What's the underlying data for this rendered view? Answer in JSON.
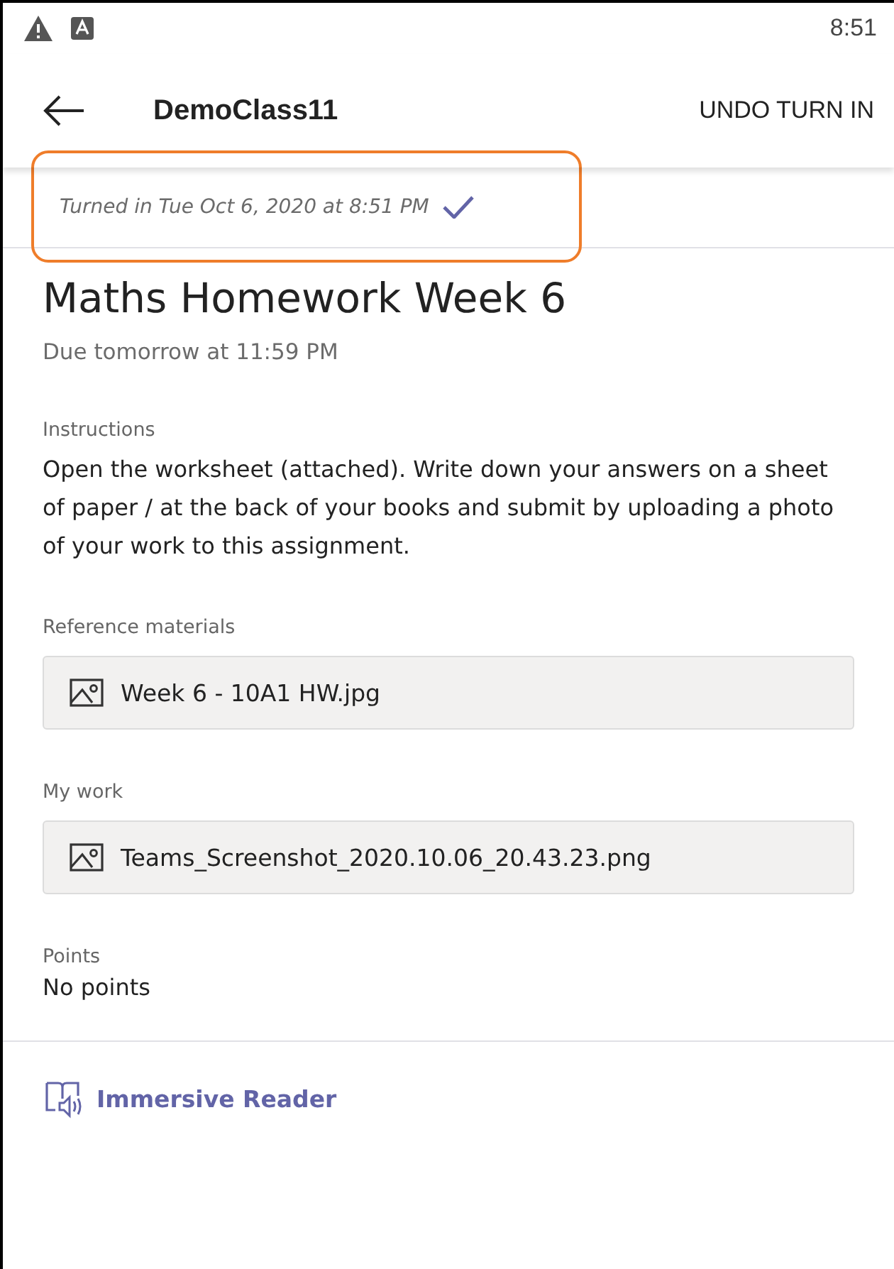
{
  "status_bar": {
    "time": "8:51"
  },
  "app_bar": {
    "title": "DemoClass11",
    "action": "UNDO TURN IN"
  },
  "turned_in": {
    "text": "Turned in Tue Oct 6, 2020 at 8:51 PM",
    "checked": true
  },
  "assignment": {
    "title": "Maths Homework Week 6",
    "due": "Due tomorrow at 11:59 PM"
  },
  "sections": [
    {
      "label": "Instructions",
      "kind": "text",
      "text": "Open the worksheet (attached).  Write down your answers on a sheet of paper / at the back of your books and submit by uploading a photo of your work to this assignment."
    },
    {
      "label": "Reference materials",
      "kind": "file",
      "file": "Week 6 - 10A1 HW.jpg"
    },
    {
      "label": "My work",
      "kind": "file",
      "file": "Teams_Screenshot_2020.10.06_20.43.23.png"
    },
    {
      "label": "Points",
      "kind": "value",
      "text": "No points"
    }
  ],
  "immersive_reader": {
    "label": "Immersive Reader"
  }
}
